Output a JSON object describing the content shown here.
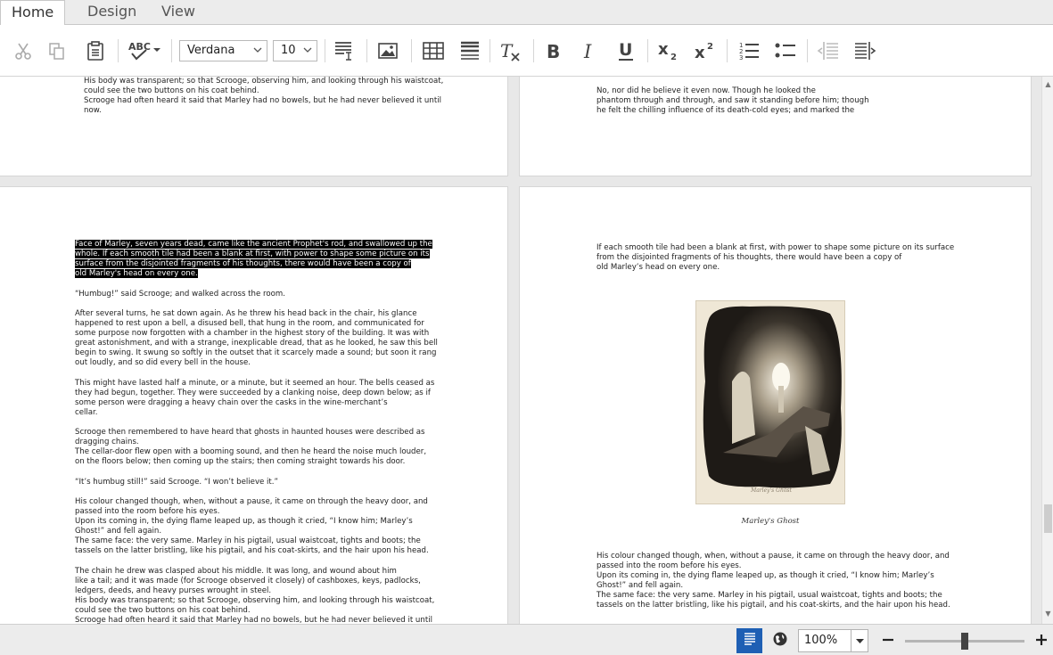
{
  "tabs": [
    {
      "label": "Home",
      "active": true
    },
    {
      "label": "Design",
      "active": false
    },
    {
      "label": "View",
      "active": false
    }
  ],
  "toolbar": {
    "font_family": "Verdana",
    "font_size": "10",
    "icons": [
      "cut-icon",
      "copy-icon",
      "paste-icon",
      "spellcheck-icon",
      "paragraph-style-icon",
      "insert-image-icon",
      "insert-table-icon",
      "horizontal-rule-icon",
      "clear-format-icon",
      "bold-icon",
      "italic-icon",
      "underline-icon",
      "subscript-icon",
      "superscript-icon",
      "numbered-list-icon",
      "bullet-list-icon",
      "decrease-indent-icon",
      "increase-indent-icon"
    ]
  },
  "pages": {
    "top_left": [
      "His body was transparent; so that Scrooge, observing him, and looking through his waistcoat,",
      "could see the two buttons on his coat behind.",
      "Scrooge had often heard it said that Marley had no bowels, but he had never believed it until",
      "now."
    ],
    "top_right": [
      "No, nor did he believe it even now. Though he looked the",
      "phantom through and through, and saw it standing before him; though",
      "he felt the chilling influence of its death-cold eyes; and marked the"
    ],
    "left_selected": [
      "Face of Marley, seven years dead, came like the ancient Prophet's rod, and swallowed up the",
      "whole. If each smooth tile had been a blank at first, with power to shape some picture on its",
      "surface from the disjointed fragments of his thoughts, there would have been a copy of",
      "old Marley's head on every one."
    ],
    "left_paragraphs": [
      [
        "“Humbug!” said Scrooge; and walked across the room."
      ],
      [
        "After several turns, he sat down again. As he threw his head back in the chair, his glance",
        "happened to rest upon a bell, a disused bell, that hung in the room, and communicated for",
        "some purpose now forgotten with a chamber in the highest story of the building. It was with",
        "great astonishment, and with a strange, inexplicable dread, that as he looked, he saw this bell",
        "begin to swing. It swung so softly in the outset that it scarcely made a sound; but soon it rang",
        "out loudly, and so did every bell in the house."
      ],
      [
        "This might have lasted half a minute, or a minute, but it seemed an hour. The bells ceased as",
        "they had begun, together. They were succeeded by a clanking noise, deep down below; as if",
        "some person were dragging a heavy chain over the casks in the wine-merchant’s",
        "cellar."
      ],
      [
        "Scrooge then remembered to have heard that ghosts in haunted houses were described as",
        "dragging chains.",
        "The cellar-door flew open with a booming sound, and then he heard the noise much louder,",
        "on the floors below; then coming up the stairs; then coming straight towards his door."
      ],
      [
        "“It’s humbug still!” said Scrooge. “I won’t believe it.”"
      ],
      [
        "His colour changed though, when, without a pause, it came on through the heavy door, and",
        "passed into the room before his eyes.",
        "Upon its coming in, the dying flame leaped up, as though it cried, “I know him; Marley’s",
        "Ghost!” and fell again.",
        "The same face: the very same. Marley in his pigtail, usual waistcoat, tights and boots; the",
        "tassels on the latter bristling, like his pigtail, and his coat-skirts, and the hair upon his head."
      ],
      [
        "The chain he drew was clasped about his middle. It was long, and wound about him",
        "like a tail; and it was made (for Scrooge observed it closely) of cashboxes, keys, padlocks,",
        "ledgers, deeds, and heavy purses wrought in steel.",
        "His body was transparent; so that Scrooge, observing him, and looking through his waistcoat,",
        "could see the two buttons on his coat behind.",
        "Scrooge had often heard it said that Marley had no bowels, but he had never believed it until"
      ]
    ],
    "right_top": [
      "If each smooth tile had been a blank at first, with power to shape some picture on its surface",
      "from the disjointed fragments of his thoughts, there would have been a copy of",
      "old Marley’s head on every one."
    ],
    "image_caption": "Marley's Ghost",
    "right_bottom": [
      "His colour changed though, when, without a pause, it came on through the heavy door, and",
      "passed into the room before his eyes.",
      "Upon its coming in, the dying flame leaped up, as though it cried, “I know him; Marley’s",
      "Ghost!” and fell again.",
      "The same face: the very same. Marley in his pigtail, usual waistcoat, tights and boots; the",
      "tassels on the latter bristling, like his pigtail, and his coat-skirts, and the hair upon his head."
    ]
  },
  "statusbar": {
    "zoom": "100%",
    "zoom_fraction": 0.5,
    "icons": [
      "print-layout-icon",
      "web-layout-icon",
      "zoom-out-icon",
      "zoom-in-icon"
    ]
  }
}
